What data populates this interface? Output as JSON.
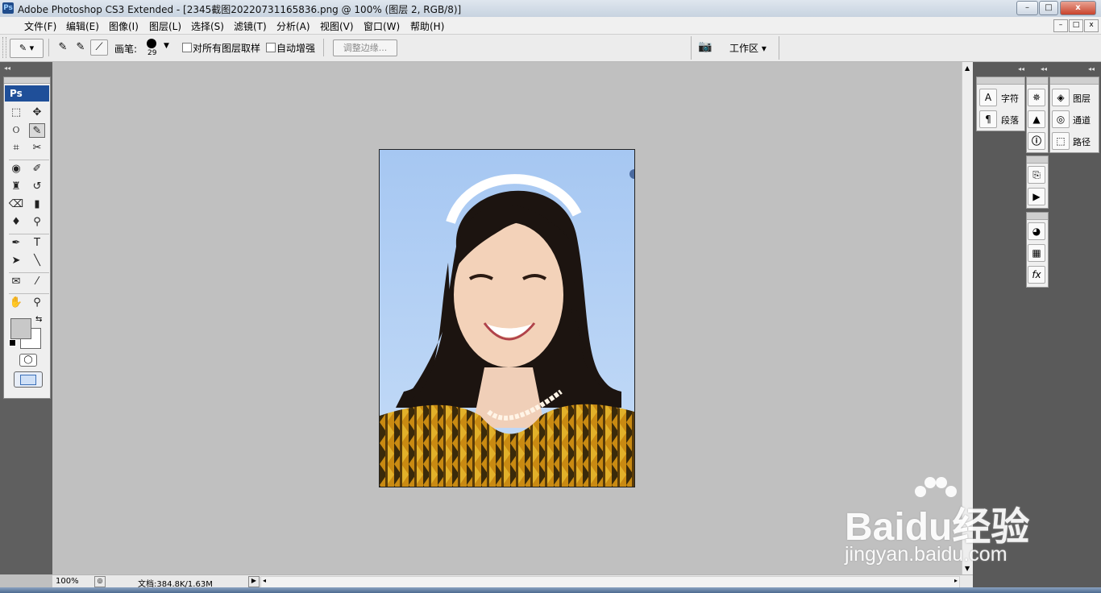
{
  "window": {
    "title": "Adobe Photoshop CS3 Extended - [2345截图20220731165836.png @ 100% (图层 2, RGB/8)]",
    "app_badge": "Ps",
    "controls": {
      "minimize": "–",
      "maximize": "□",
      "close": "x"
    }
  },
  "menubar": {
    "items": [
      "文件(F)",
      "编辑(E)",
      "图像(I)",
      "图层(L)",
      "选择(S)",
      "滤镜(T)",
      "分析(A)",
      "视图(V)",
      "窗口(W)",
      "帮助(H)"
    ],
    "doc_controls": {
      "minimize": "–",
      "restore": "□",
      "close": "x"
    }
  },
  "options": {
    "brush_label": "画笔:",
    "brush_size": "29",
    "sample_all_layers": "对所有图层取样",
    "auto_enhance": "自动增强",
    "refine_edge": "调整边缘...",
    "workspace": "工作区"
  },
  "toolbox": {
    "logo": "Ps",
    "tools": [
      {
        "name": "marquee-tool-icon",
        "glyph": "⬚"
      },
      {
        "name": "move-tool-icon",
        "glyph": "✥"
      },
      {
        "name": "lasso-tool-icon",
        "glyph": "ଠ"
      },
      {
        "name": "quick-selection-tool-icon",
        "glyph": "✎"
      },
      {
        "name": "crop-tool-icon",
        "glyph": "⌗"
      },
      {
        "name": "slice-tool-icon",
        "glyph": "✂"
      },
      {
        "name": "spot-healing-tool-icon",
        "glyph": "◉"
      },
      {
        "name": "brush-tool-icon",
        "glyph": "✐"
      },
      {
        "name": "clone-stamp-tool-icon",
        "glyph": "♜"
      },
      {
        "name": "history-brush-tool-icon",
        "glyph": "↺"
      },
      {
        "name": "eraser-tool-icon",
        "glyph": "⌫"
      },
      {
        "name": "gradient-tool-icon",
        "glyph": "▮"
      },
      {
        "name": "blur-tool-icon",
        "glyph": "♦"
      },
      {
        "name": "dodge-tool-icon",
        "glyph": "⚲"
      },
      {
        "name": "pen-tool-icon",
        "glyph": "✒"
      },
      {
        "name": "type-tool-icon",
        "glyph": "T"
      },
      {
        "name": "path-selection-tool-icon",
        "glyph": "➤"
      },
      {
        "name": "line-tool-icon",
        "glyph": "╲"
      },
      {
        "name": "notes-tool-icon",
        "glyph": "✉"
      },
      {
        "name": "eyedropper-tool-icon",
        "glyph": "⁄"
      },
      {
        "name": "hand-tool-icon",
        "glyph": "✋"
      },
      {
        "name": "zoom-tool-icon",
        "glyph": "⚲"
      }
    ]
  },
  "status": {
    "zoom": "100%",
    "doc_info": "文档:384.8K/1.63M"
  },
  "panels": {
    "character": "字符",
    "paragraph": "段落",
    "layers": "图层",
    "channels": "通道",
    "paths": "路径"
  },
  "watermark": {
    "brand": "Baidu经验",
    "url": "jingyan.baidu.com"
  },
  "colors": {
    "foreground": "#c8c8c8",
    "background": "#ffffff",
    "title_bar": "#d4dde8",
    "ps_blue": "#1f4f99"
  }
}
